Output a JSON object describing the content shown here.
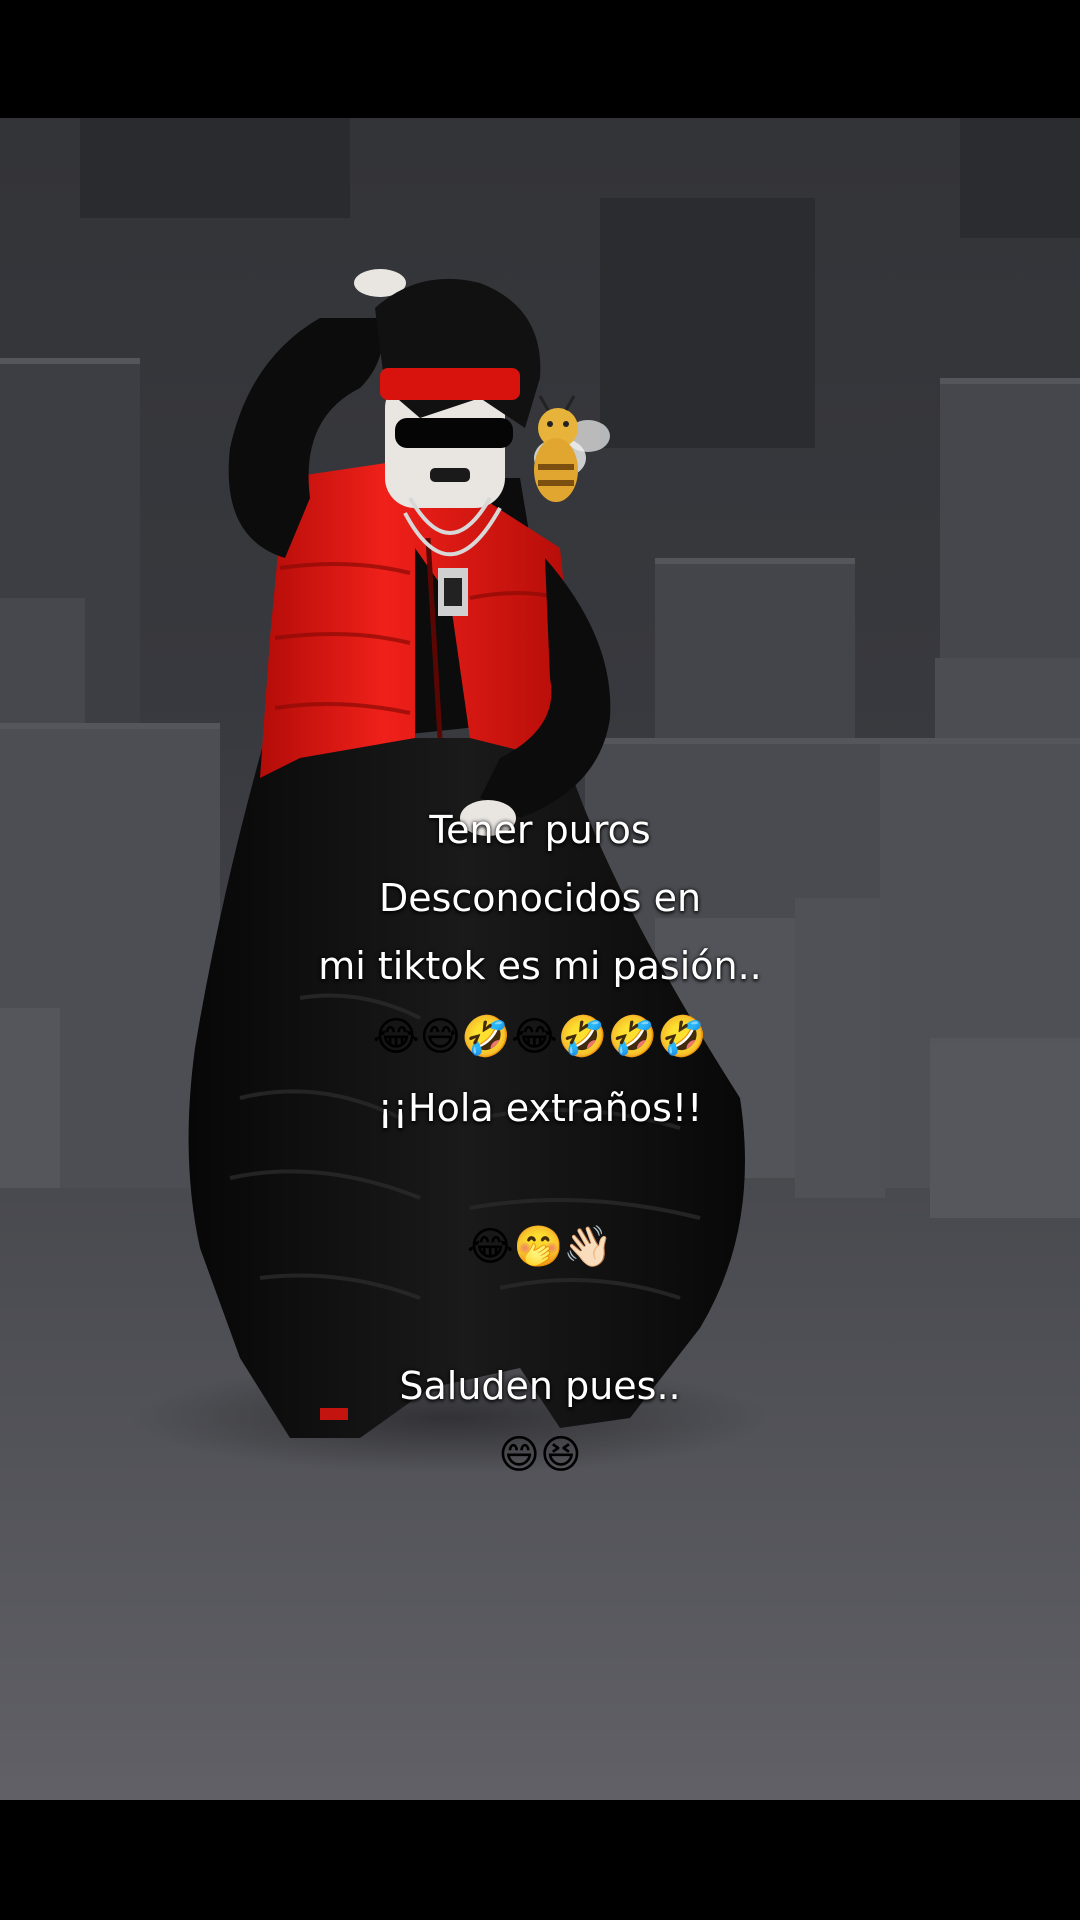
{
  "caption": {
    "line1": "Tener puros",
    "line2": "Desconocidos en",
    "line3": "mi tiktok es mi pasión..",
    "emojis1": "😂😅🤣😂🤣🤣🤣",
    "line4": "¡¡Hola extraños!!",
    "emojis2": "😂🤭👋🏻",
    "line5": "Saluden pues..",
    "emojis3": "😄😆"
  },
  "scene": {
    "description_colors": {
      "background": "#3a3b40",
      "vest": "#e3120b",
      "clothing": "#0d0d0d",
      "bee": "#e8b33a"
    }
  }
}
